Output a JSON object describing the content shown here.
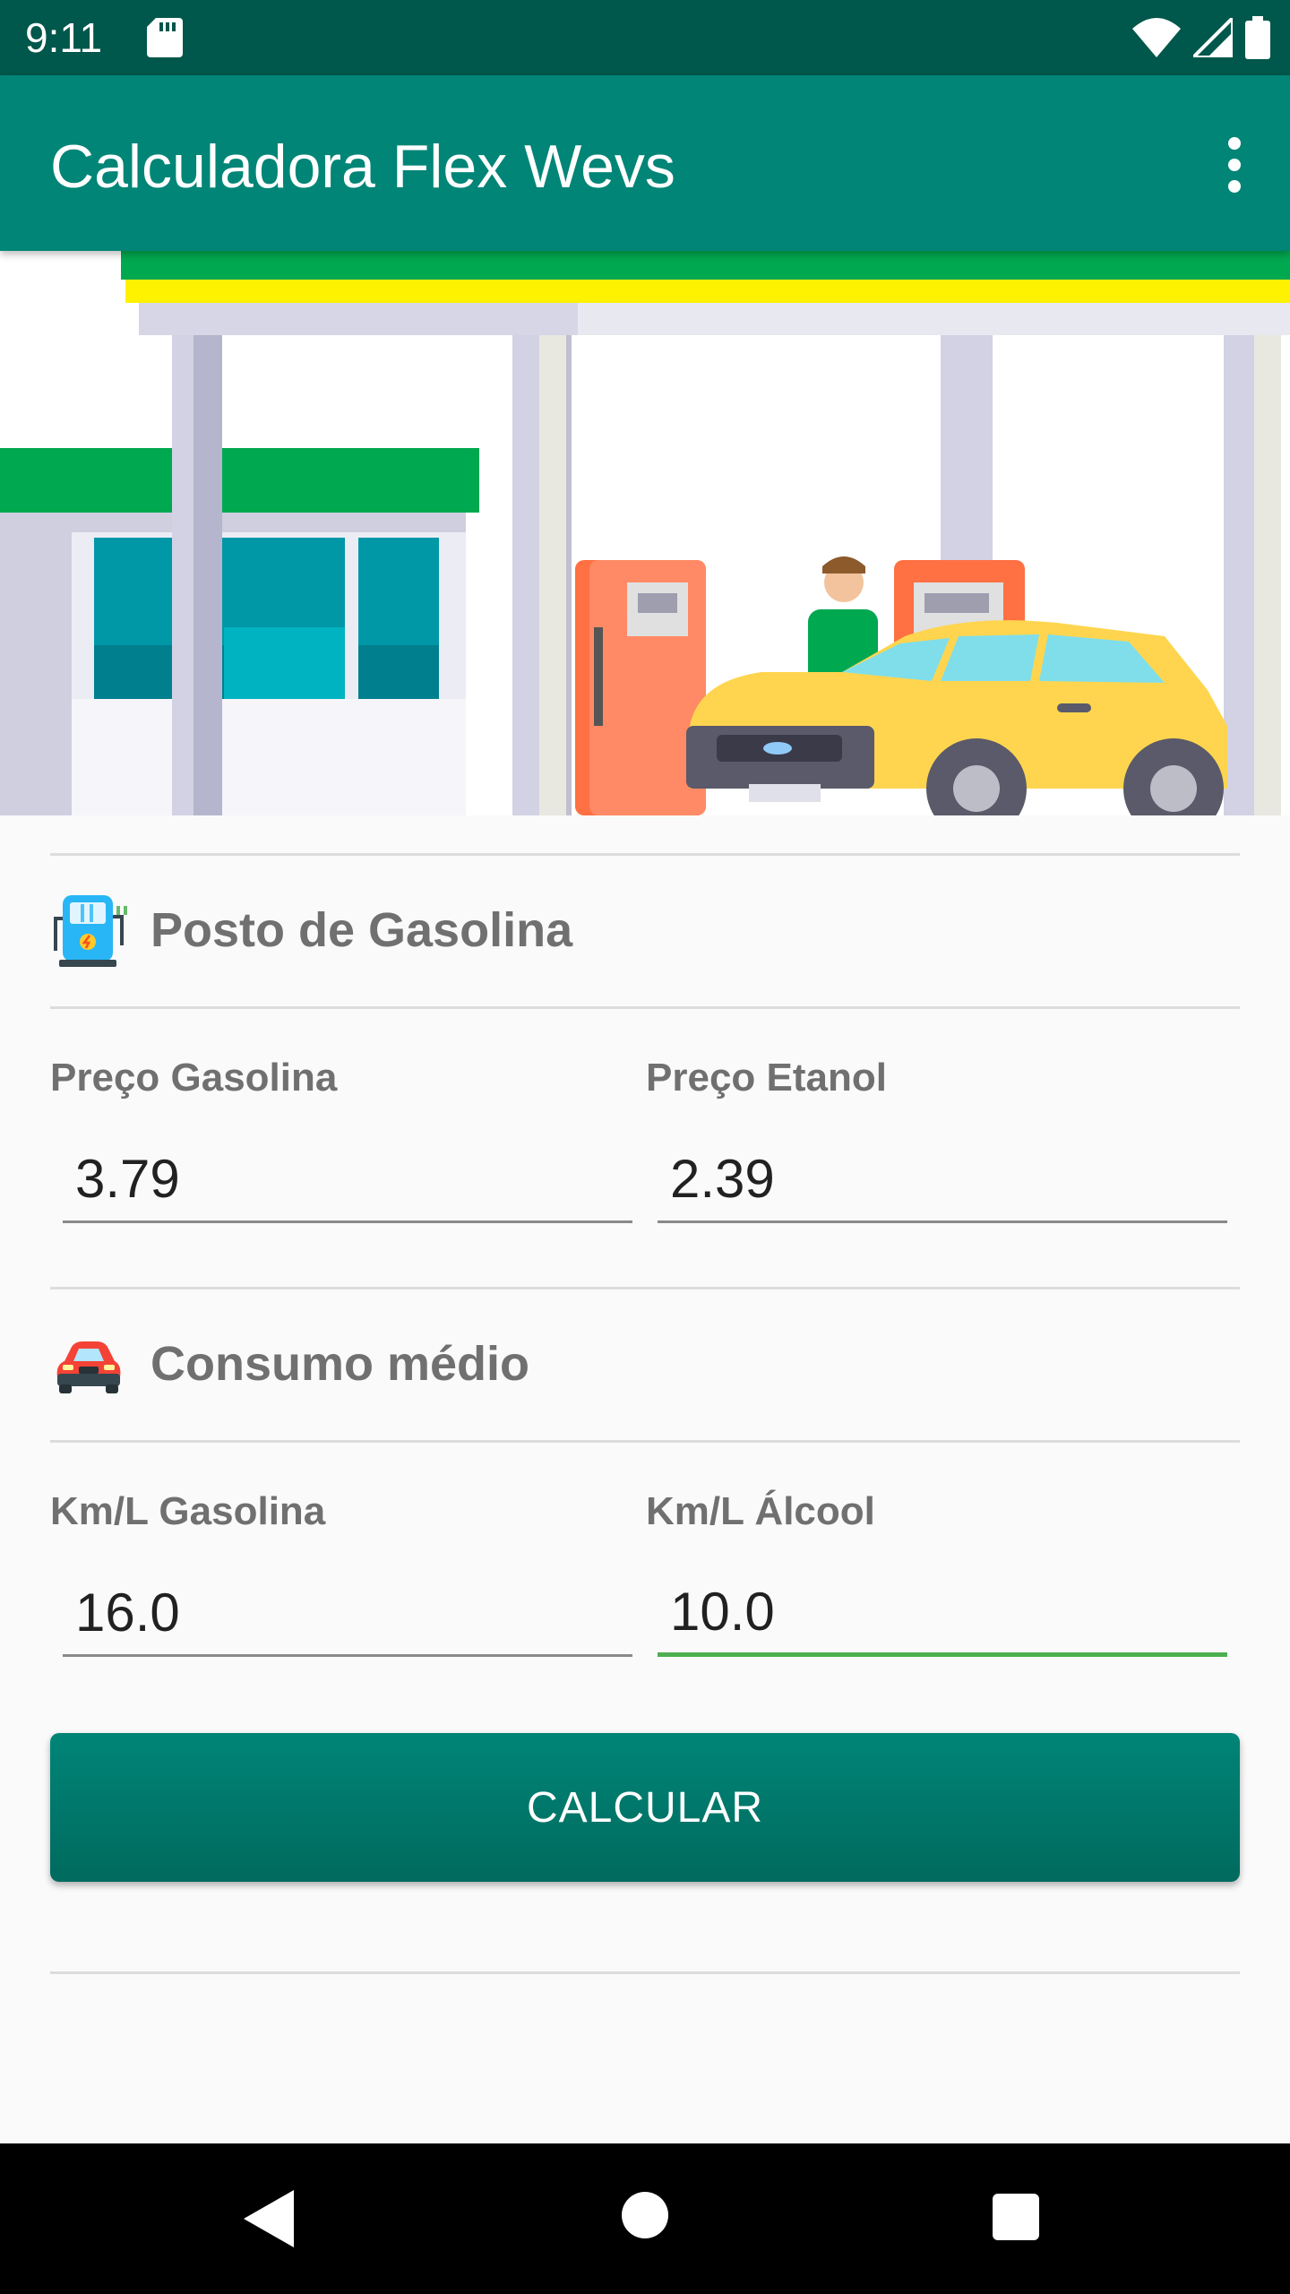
{
  "status_bar": {
    "time": "9:11"
  },
  "app_bar": {
    "title": "Calculadora Flex Wevs"
  },
  "icons": {
    "sd": "sd-card-icon",
    "wifi": "wifi-icon",
    "signal": "signal-icon",
    "battery": "battery-icon",
    "overflow": "more-vert-icon",
    "gas_station": "gas-station-icon",
    "car": "car-icon",
    "back": "back-icon",
    "home": "home-icon",
    "recents": "recents-icon"
  },
  "sections": {
    "station": {
      "title": "Posto de Gasolina"
    },
    "consumption": {
      "title": "Consumo médio"
    }
  },
  "fields": {
    "gas_price": {
      "label": "Preço Gasolina",
      "value": "3.79"
    },
    "ethanol_price": {
      "label": "Preço Etanol",
      "value": "2.39"
    },
    "km_gas": {
      "label": "Km/L Gasolina",
      "value": "16.0"
    },
    "km_alcohol": {
      "label": "Km/L Álcool",
      "value": "10.0"
    }
  },
  "button": {
    "label": "CALCULAR"
  },
  "colors": {
    "primary": "#008577",
    "primary_dark": "#00574b",
    "accent": "#4caf50"
  }
}
